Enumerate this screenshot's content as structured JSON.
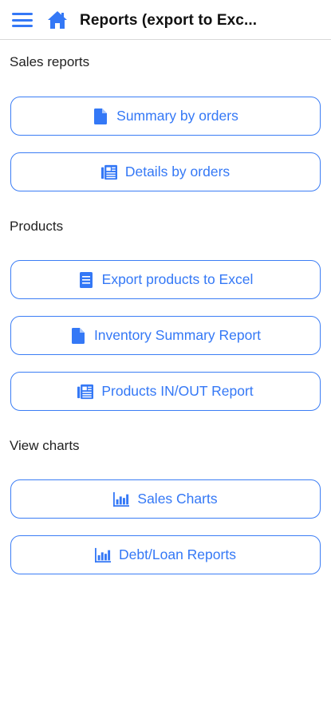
{
  "header": {
    "title": "Reports (export to Exc...",
    "menu_icon": "hamburger-menu-icon",
    "home_icon": "home-icon",
    "accent": "#3478f6"
  },
  "sections": [
    {
      "title": "Sales reports",
      "buttons": [
        {
          "label": "Summary by orders",
          "icon": "file-icon"
        },
        {
          "label": "Details by orders",
          "icon": "newspaper-icon"
        }
      ]
    },
    {
      "title": "Products",
      "buttons": [
        {
          "label": "Export products to Excel",
          "icon": "file-text-icon"
        },
        {
          "label": "Inventory Summary Report",
          "icon": "file-icon"
        },
        {
          "label": "Products IN/OUT Report",
          "icon": "newspaper-icon"
        }
      ]
    },
    {
      "title": "View charts",
      "buttons": [
        {
          "label": "Sales Charts",
          "icon": "bar-chart-icon"
        },
        {
          "label": "Debt/Loan Reports",
          "icon": "bar-chart-icon"
        }
      ]
    }
  ]
}
